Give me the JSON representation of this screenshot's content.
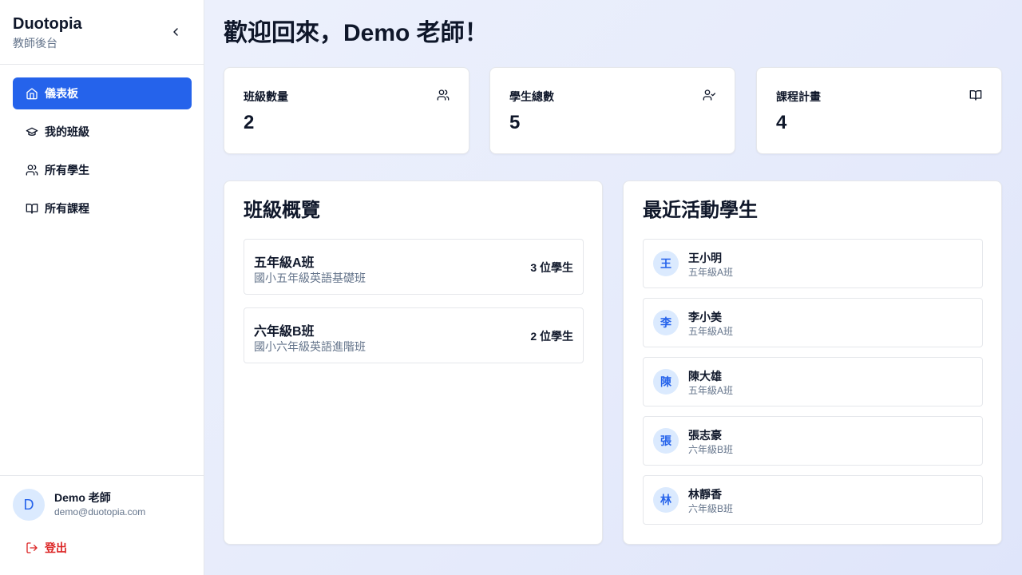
{
  "sidebar": {
    "brand_title": "Duotopia",
    "brand_subtitle": "教師後台",
    "items": [
      {
        "label": "儀表板",
        "icon": "home-icon",
        "active": true
      },
      {
        "label": "我的班級",
        "icon": "graduation-cap-icon",
        "active": false
      },
      {
        "label": "所有學生",
        "icon": "users-icon",
        "active": false
      },
      {
        "label": "所有課程",
        "icon": "book-open-icon",
        "active": false
      }
    ],
    "user": {
      "avatar_initial": "D",
      "name": "Demo 老師",
      "email": "demo@duotopia.com"
    },
    "logout_label": "登出"
  },
  "main": {
    "title": "歡迎回來，Demo 老師！",
    "stats": [
      {
        "label": "班級數量",
        "value": "2",
        "icon": "users-icon"
      },
      {
        "label": "學生總數",
        "value": "5",
        "icon": "user-check-icon"
      },
      {
        "label": "課程計畫",
        "value": "4",
        "icon": "book-open-icon"
      }
    ],
    "classes_panel": {
      "title": "班級概覽",
      "items": [
        {
          "name": "五年級A班",
          "description": "國小五年級英語基礎班",
          "count": "3 位學生"
        },
        {
          "name": "六年級B班",
          "description": "國小六年級英語進階班",
          "count": "2 位學生"
        }
      ]
    },
    "students_panel": {
      "title": "最近活動學生",
      "items": [
        {
          "initial": "王",
          "name": "王小明",
          "class": "五年級A班"
        },
        {
          "initial": "李",
          "name": "李小美",
          "class": "五年級A班"
        },
        {
          "initial": "陳",
          "name": "陳大雄",
          "class": "五年級A班"
        },
        {
          "initial": "張",
          "name": "張志豪",
          "class": "六年級B班"
        },
        {
          "initial": "林",
          "name": "林靜香",
          "class": "六年級B班"
        }
      ]
    }
  },
  "colors": {
    "accent": "#2563eb",
    "danger": "#dc2626",
    "avatar_bg": "#dbeafe"
  }
}
